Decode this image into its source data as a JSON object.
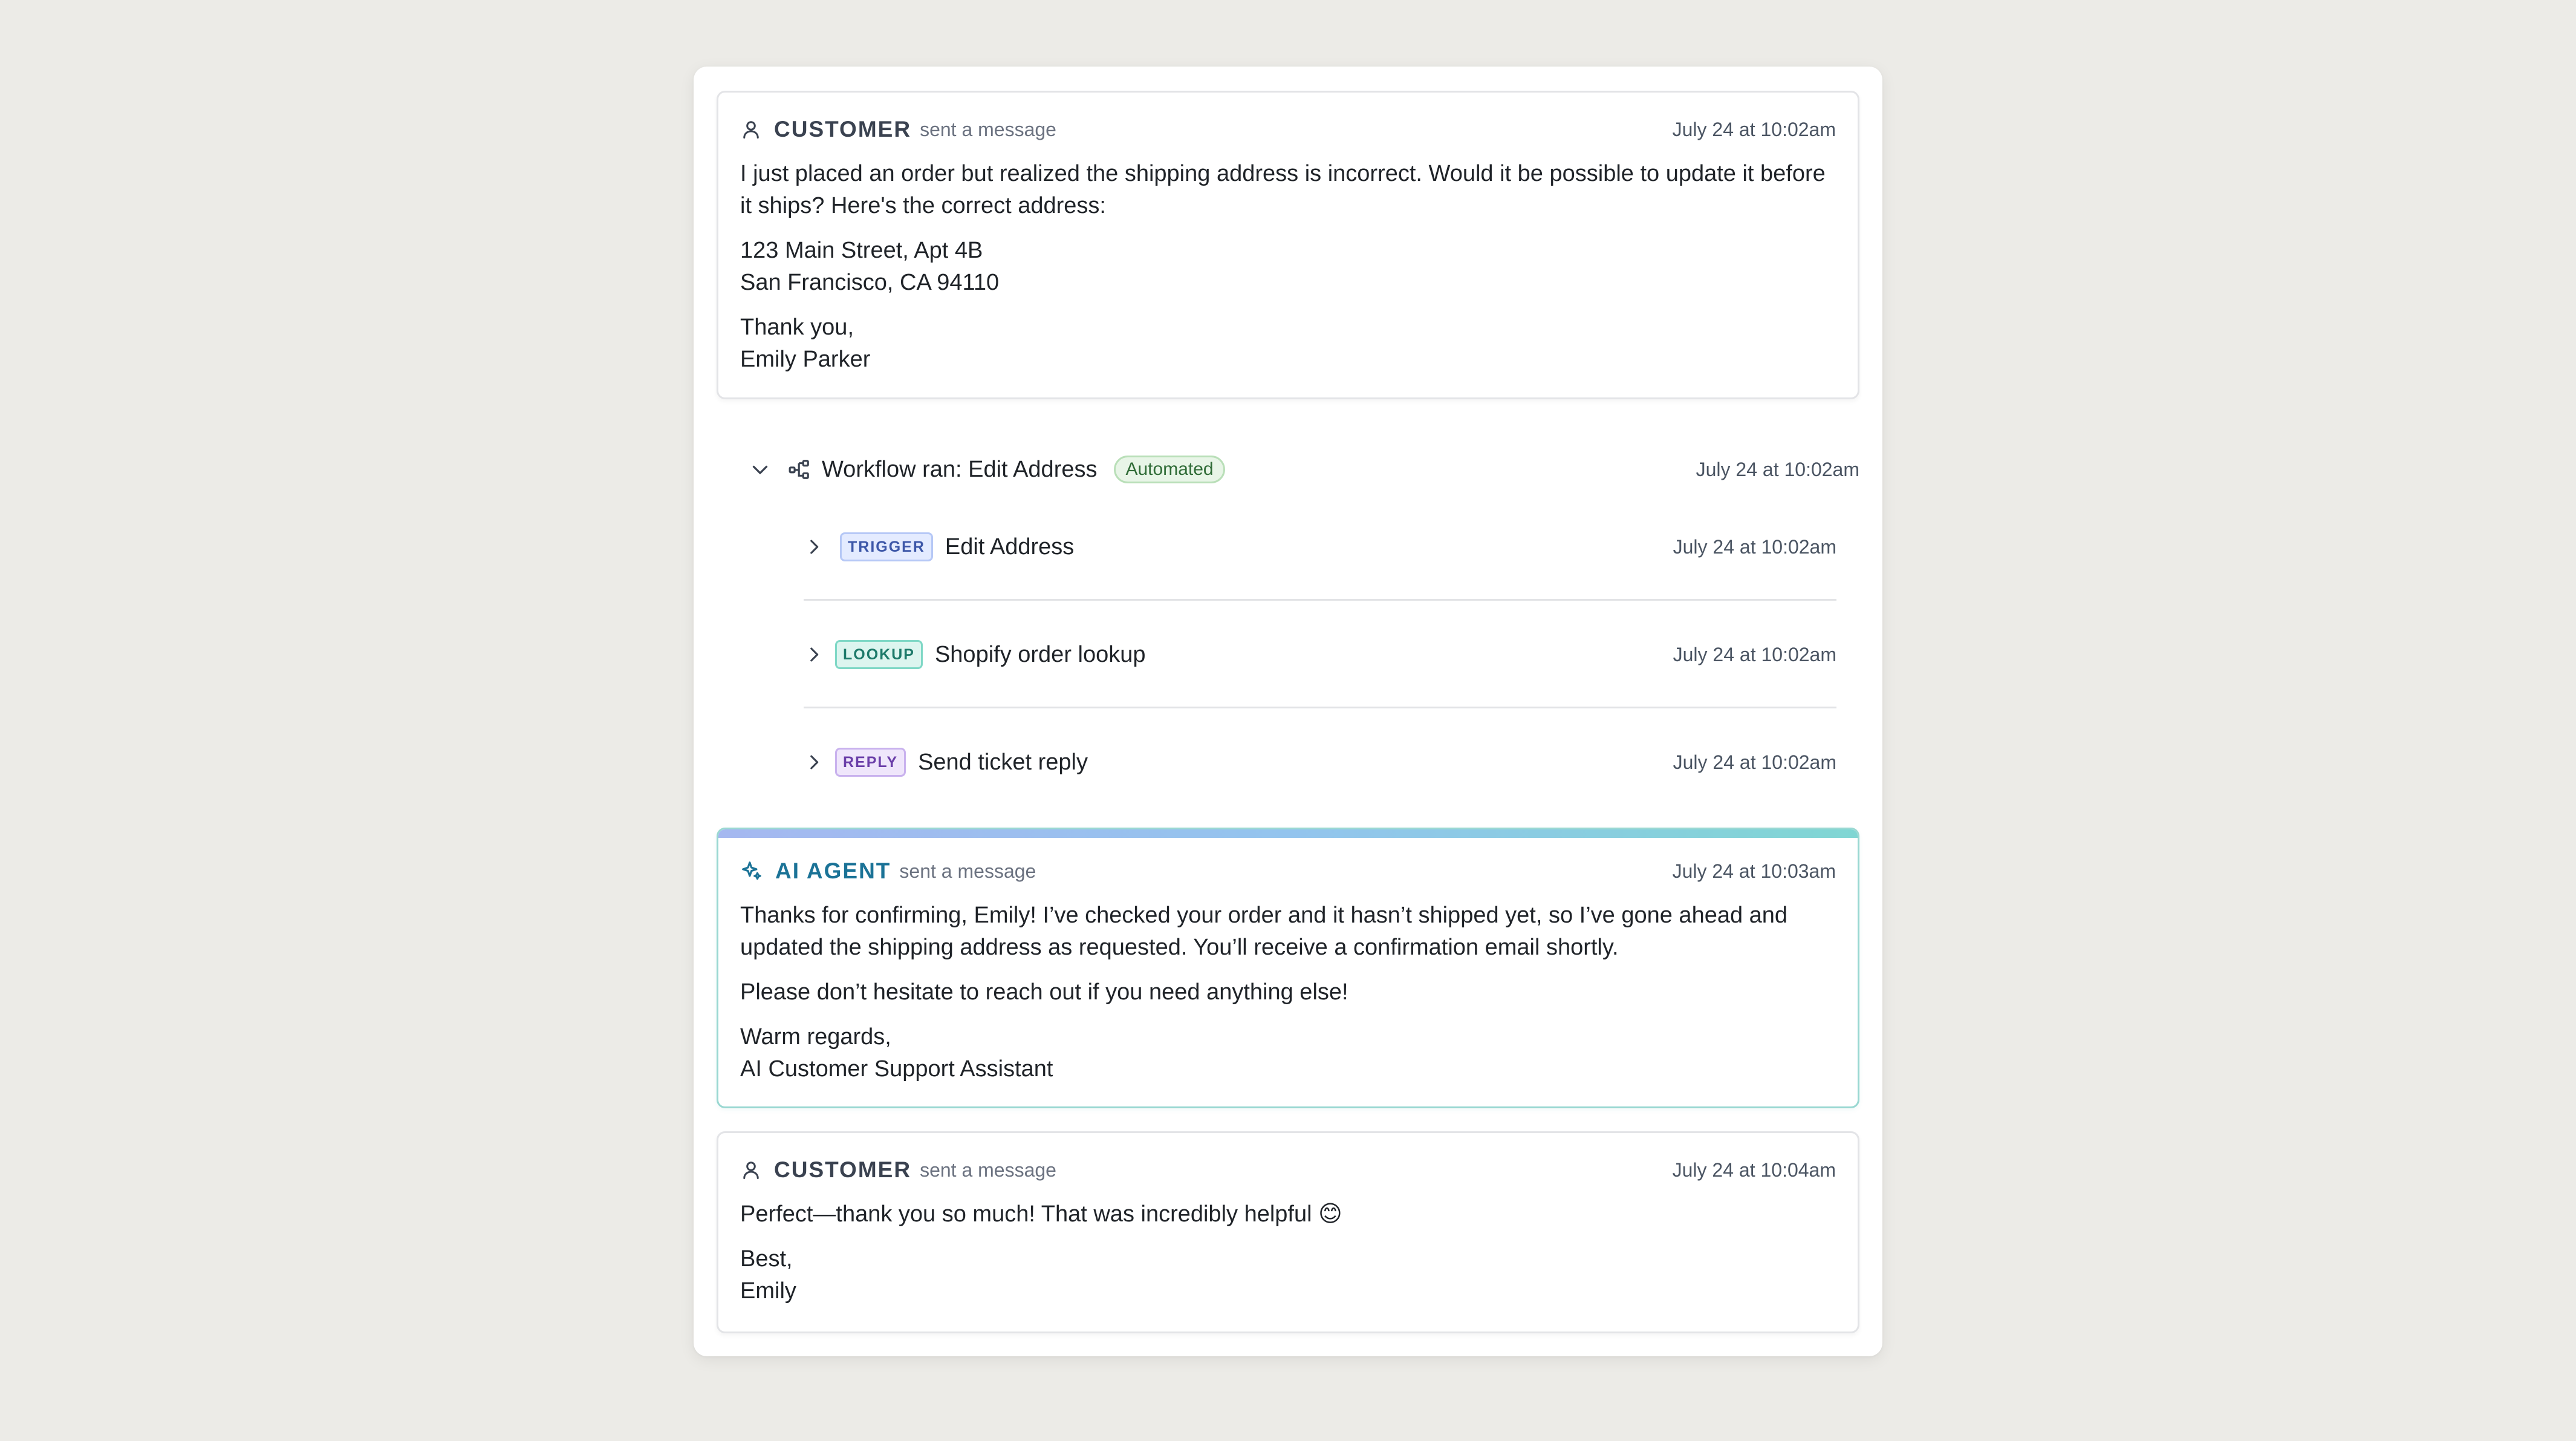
{
  "messages": [
    {
      "role": "CUSTOMER",
      "action": "sent a message",
      "time": "July 24 at 10:02am",
      "paragraphs": [
        "I just placed an order but realized the shipping address is incorrect. Would it be possible to update it before it ships? Here's the correct address:",
        "123 Main Street, Apt 4B\nSan Francisco, CA 94110",
        "Thank you,\nEmily Parker"
      ]
    },
    {
      "role": "AI AGENT",
      "action": "sent a message",
      "time": "July 24 at 10:03am",
      "paragraphs": [
        "Thanks for confirming, Emily! I’ve checked your order and it hasn’t shipped yet, so I’ve gone ahead and updated the shipping address as requested. You’ll receive a confirmation email shortly.",
        "Please don’t hesitate to reach out if you need anything else!",
        "Warm regards,\nAI Customer Support Assistant"
      ]
    },
    {
      "role": "CUSTOMER",
      "action": "sent a message",
      "time": "July 24 at 10:04am",
      "paragraphs": [
        "Perfect—thank you so much! That was incredibly helpful 😊",
        "Best,\nEmily"
      ]
    }
  ],
  "workflow": {
    "title": "Workflow ran: Edit Address",
    "badge": "Automated",
    "time": "July 24 at 10:02am",
    "steps": [
      {
        "tag": "TRIGGER",
        "label": "Edit Address",
        "time": "July 24 at 10:02am"
      },
      {
        "tag": "LOOKUP",
        "label": "Shopify order lookup",
        "time": "July 24 at 10:02am"
      },
      {
        "tag": "REPLY",
        "label": "Send ticket reply",
        "time": "July 24 at 10:02am"
      }
    ]
  },
  "icons": {
    "customer": "user-icon",
    "ai_agent": "sparkle-icon",
    "workflow": "workflow-icon",
    "collapse": "chevron-down-icon",
    "expand": "chevron-right-icon"
  },
  "colors": {
    "ai_accent": "#1b7397",
    "automated_badge": "#2f6b36",
    "trigger_tag": "#3d57a8",
    "lookup_tag": "#1d7a6a",
    "reply_tag": "#6b3fa9"
  }
}
